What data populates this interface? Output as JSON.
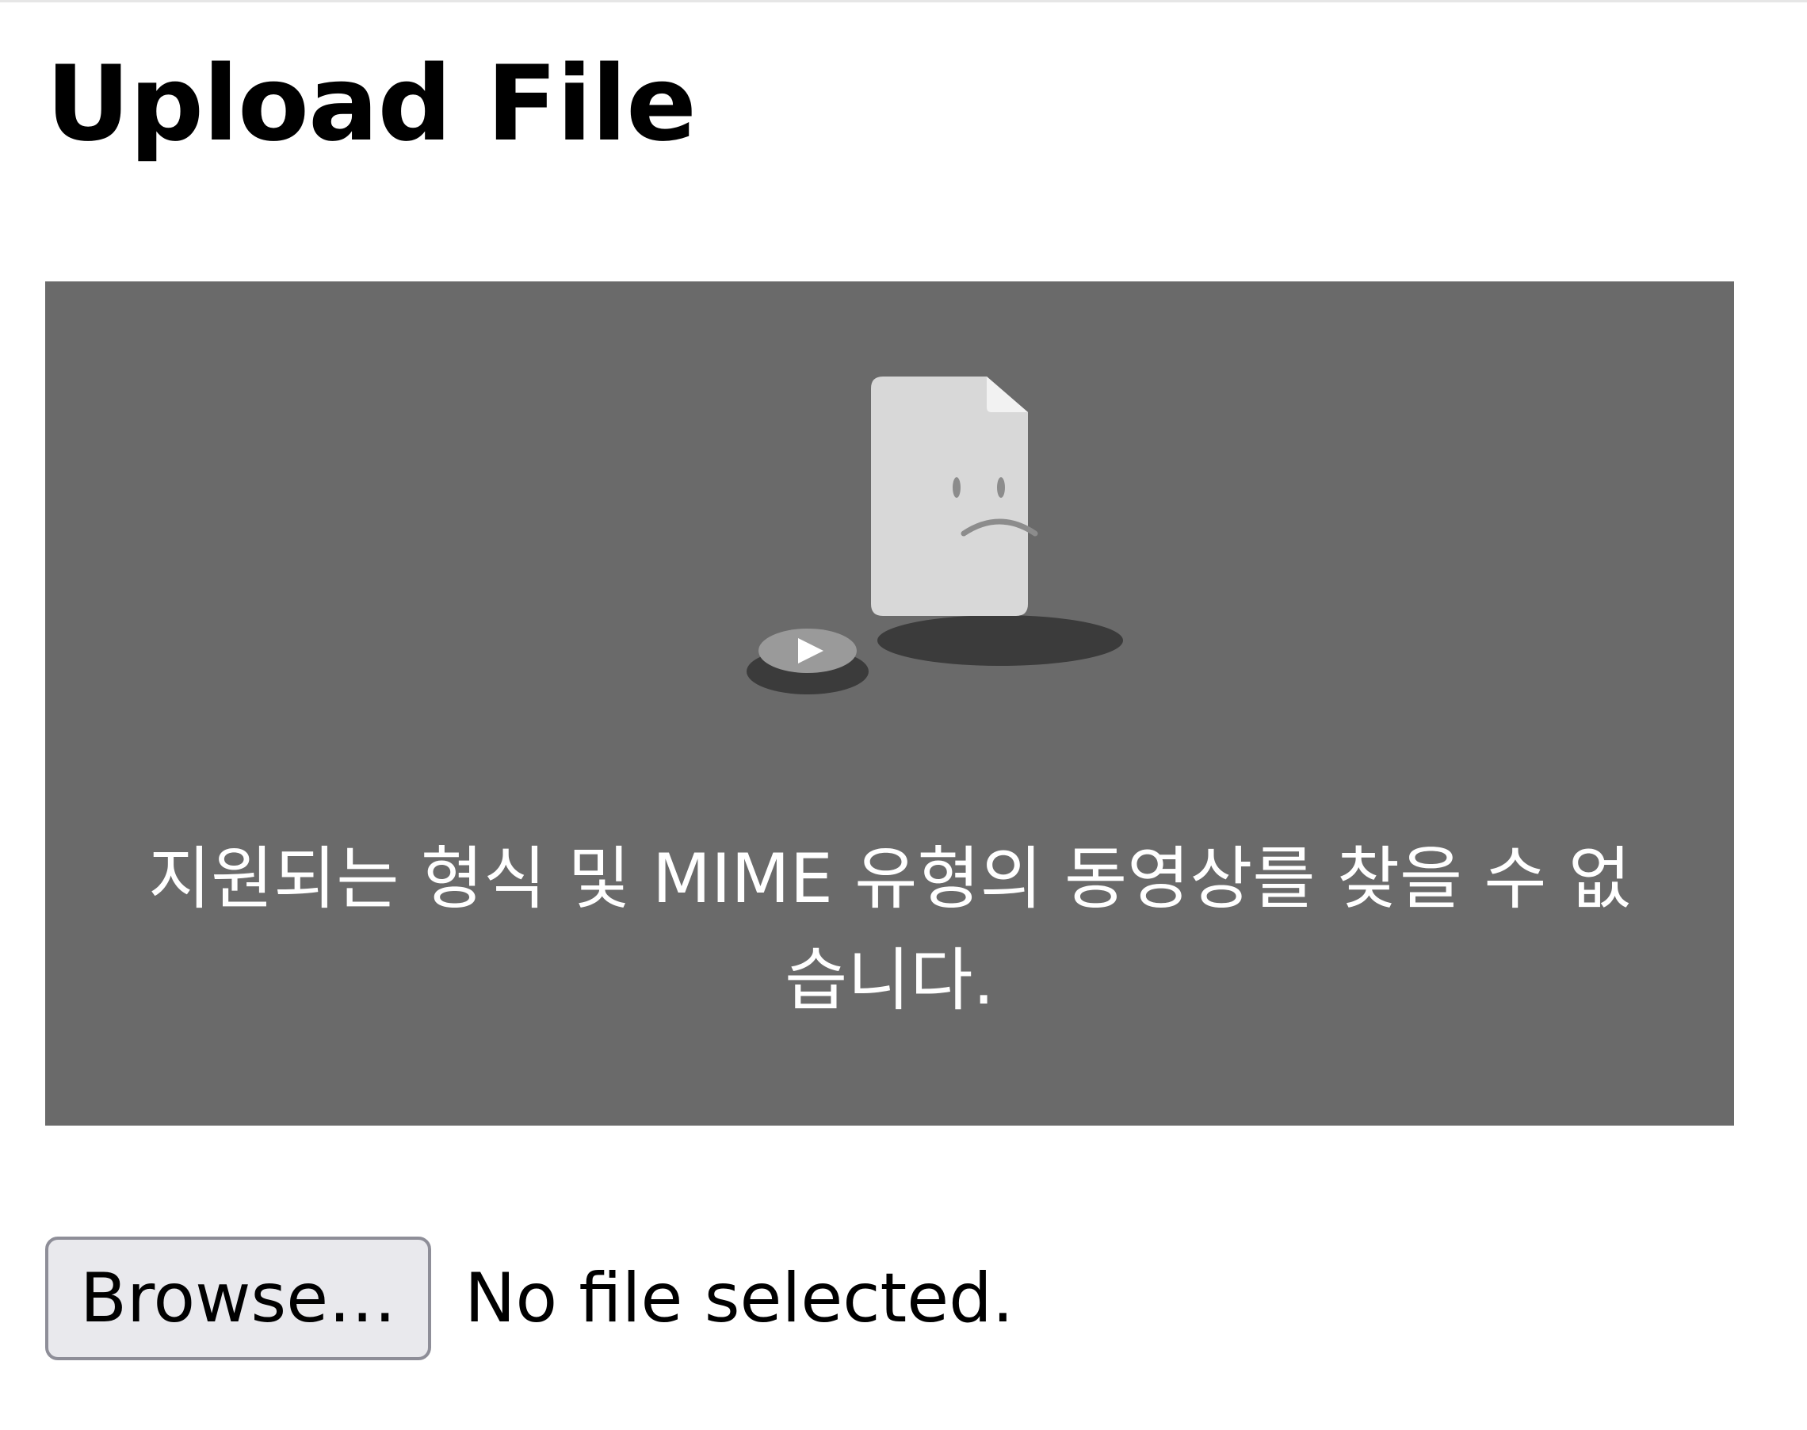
{
  "page": {
    "title": "Upload File"
  },
  "video": {
    "error_message": "지원되는 형식 및 MIME 유형의 동영상를 찾을 수 없습니다.",
    "icons": [
      "sad-document-icon",
      "play-disc-icon"
    ],
    "colors": {
      "background": "#6a6a6a",
      "paper": "#d8d8d8",
      "shadow": "#3b3b3b"
    }
  },
  "file_input": {
    "button_label": "Browse…",
    "status": "No file selected."
  }
}
